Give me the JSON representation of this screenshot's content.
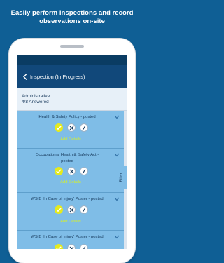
{
  "headline": {
    "line1": "Easily perform inspections and record",
    "line2": "observations on-site"
  },
  "appbar": {
    "title": "Inspection (In Progress)",
    "back_icon": "chevron-left-icon"
  },
  "section": {
    "title": "Administrative",
    "subtitle": "4/8 Answered"
  },
  "items": [
    {
      "title": "Health & Safety Policy - posted",
      "add_label": "Add Details"
    },
    {
      "title_line1": "Occupational Health & Safety Act -",
      "title_line2": "posted",
      "add_label": "Add Details"
    },
    {
      "title": "WSIB 'In Case of Injury' Poster - posted",
      "add_label": "Add Details"
    },
    {
      "title": "WSIB 'In Case of Injury' Poster - posted"
    }
  ],
  "filter_tab": {
    "label": "Filter"
  },
  "colors": {
    "background": "#0f5f95",
    "appbar": "#11487a",
    "card": "#7fbde7",
    "yes_button": "#e5ea1f",
    "add_details": "#d6f02a"
  }
}
